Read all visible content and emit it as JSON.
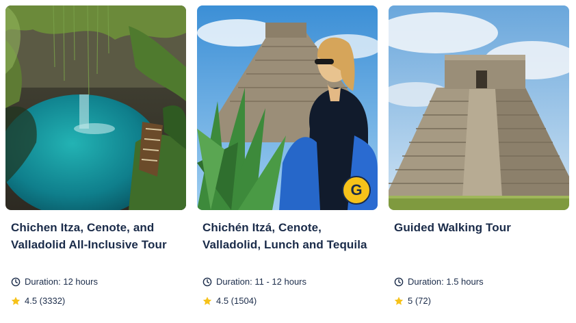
{
  "cards": [
    {
      "title": "Chichen Itza, Cenote, and Valladolid All-Inclusive Tour",
      "duration": "Duration: 12 hours",
      "rating": "4.5 (3332)",
      "image_icon": "cenote-photo"
    },
    {
      "title": "Chichén Itzá, Cenote, Valladolid, Lunch and Tequila",
      "duration": "Duration: 11 - 12 hours",
      "rating": "4.5 (1504)",
      "image_icon": "pyramid-with-woman-photo",
      "badge": "G"
    },
    {
      "title": "Guided Walking Tour",
      "duration": "Duration: 1.5 hours",
      "rating": "5 (72)",
      "image_icon": "pyramid-photo"
    }
  ],
  "colors": {
    "text": "#1a2b49",
    "star": "#f6c21a",
    "badge": "#f6c21a"
  }
}
